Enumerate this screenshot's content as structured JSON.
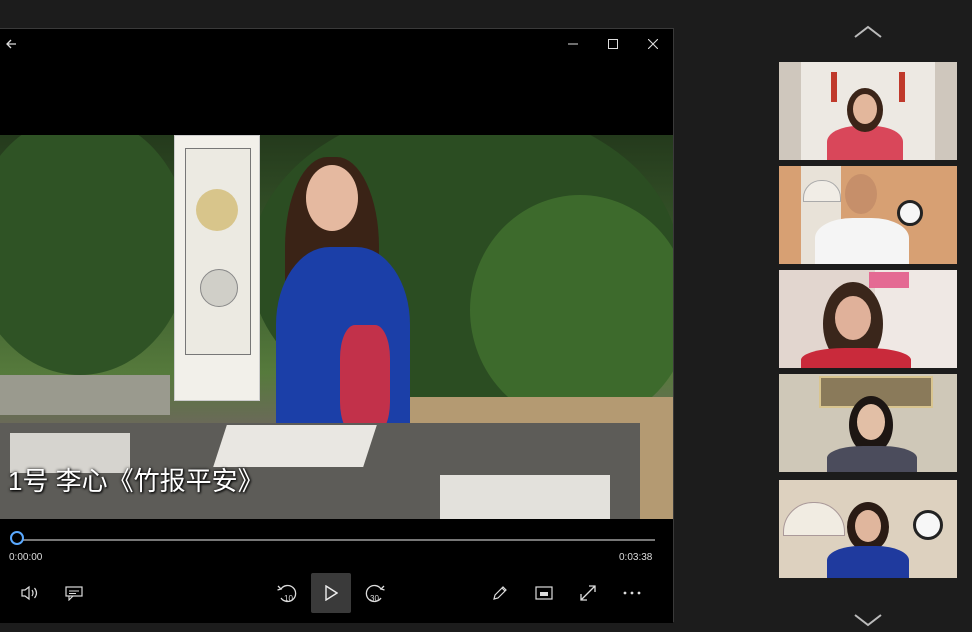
{
  "player": {
    "subtitle": "1号 李心《竹报平安》",
    "current_time": "0:00:00",
    "duration": "0:03:38",
    "progress": 0.0,
    "skip_back_seconds": "10",
    "skip_forward_seconds": "30",
    "icons": {
      "back": "back-arrow-icon",
      "minimize": "minimize-icon",
      "maximize": "maximize-icon",
      "close": "close-icon",
      "volume": "volume-icon",
      "captions": "captions-icon",
      "play": "play-icon",
      "pen": "pen-icon",
      "mini_view": "mini-view-icon",
      "fullscreen": "fullscreen-icon",
      "more": "more-icon"
    }
  },
  "participants": {
    "count_visible": 5,
    "icons": {
      "up": "chevron-up-icon",
      "down": "chevron-down-icon"
    }
  },
  "colors": {
    "accent": "#5aa9ff",
    "background": "#1c1c1c",
    "player_bg": "#000000"
  }
}
